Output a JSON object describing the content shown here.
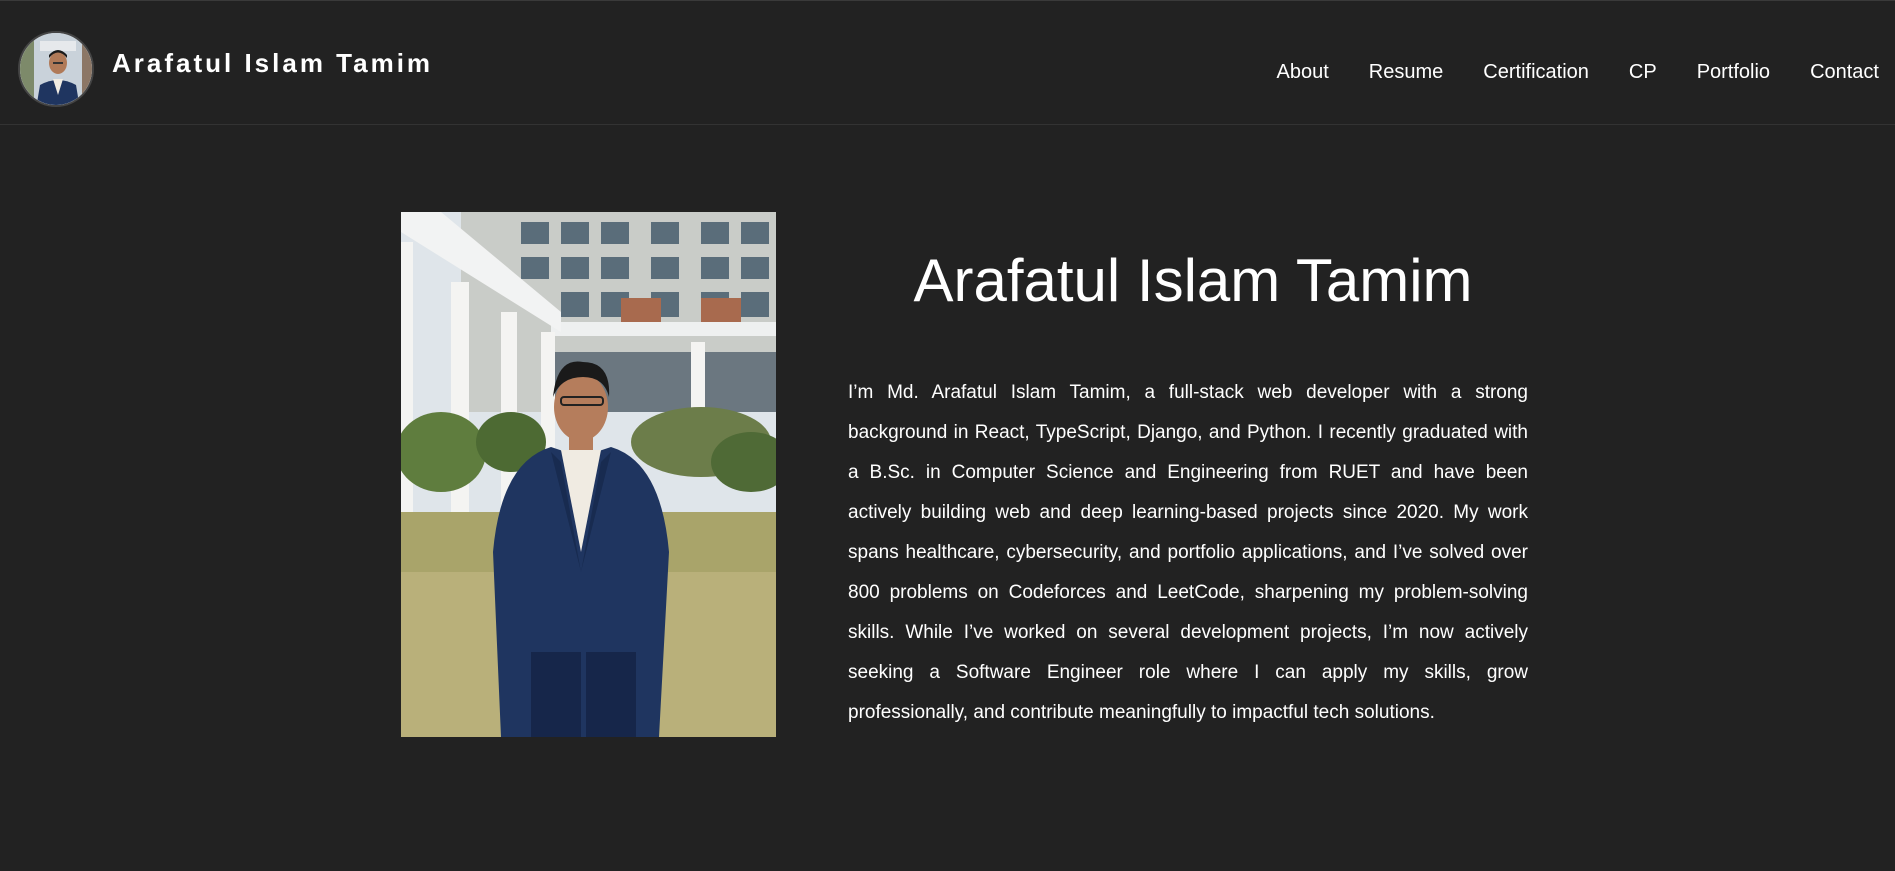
{
  "header": {
    "brand_name": "Arafatul Islam Tamim",
    "nav": {
      "about": "About",
      "resume": "Resume",
      "certification": "Certification",
      "cp": "CP",
      "portfolio": "Portfolio",
      "contact": "Contact"
    }
  },
  "main": {
    "title": "Arafatul Islam Tamim",
    "bio": "I’m Md. Arafatul Islam Tamim, a full-stack web developer with a strong background in React, TypeScript, Django, and Python. I recently graduated with a B.Sc. in Computer Science and Engineering from RUET and have been actively building web and deep learning-based projects since 2020. My work spans healthcare, cybersecurity, and portfolio applications, and I’ve solved over 800 problems on Codeforces and LeetCode, sharpening my problem-solving skills. While I’ve worked on several development projects, I’m now actively seeking a Software Engineer role where I can apply my skills, grow professionally, and contribute meaningfully to impactful tech solutions."
  },
  "colors": {
    "background": "#222222",
    "text": "#ffffff",
    "suit": "#1f3560"
  }
}
